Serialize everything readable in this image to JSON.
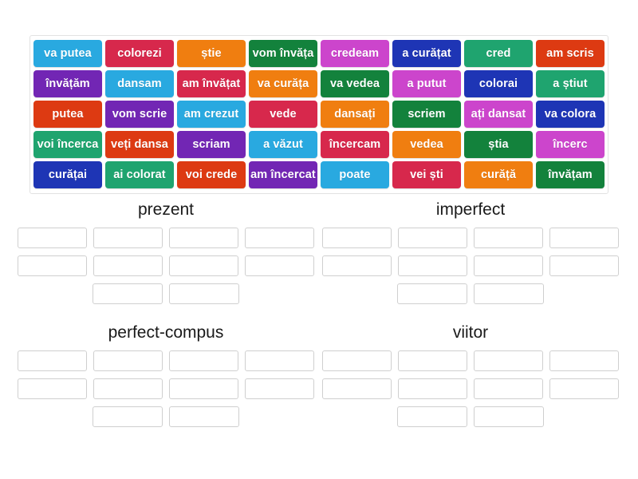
{
  "app": {
    "type": "drag-and-drop-group-sort-activity",
    "language": "ro"
  },
  "palette": {
    "sky": "#29a9e0",
    "crimson": "#d7284c",
    "orange": "#f07e10",
    "forest": "#13823c",
    "orchid": "#cc45cc",
    "navy": "#1e35b5",
    "emerald": "#1fa46f",
    "vermilion": "#dd3a12",
    "purple": "#7226b4"
  },
  "word_bank": {
    "name": "word-bank",
    "rows": [
      [
        {
          "label": "va putea",
          "color": "#29a9e0"
        },
        {
          "label": "colorezi",
          "color": "#d7284c"
        },
        {
          "label": "știe",
          "color": "#f07e10"
        },
        {
          "label": "vom învăța",
          "color": "#13823c"
        },
        {
          "label": "credeam",
          "color": "#cc45cc"
        },
        {
          "label": "a curățat",
          "color": "#1e35b5"
        },
        {
          "label": "cred",
          "color": "#1fa46f"
        },
        {
          "label": "am scris",
          "color": "#dd3a12"
        }
      ],
      [
        {
          "label": "învățăm",
          "color": "#7226b4"
        },
        {
          "label": "dansam",
          "color": "#29a9e0"
        },
        {
          "label": "am învățat",
          "color": "#d7284c"
        },
        {
          "label": "va curăța",
          "color": "#f07e10"
        },
        {
          "label": "va vedea",
          "color": "#13823c"
        },
        {
          "label": "a putut",
          "color": "#cc45cc"
        },
        {
          "label": "colorai",
          "color": "#1e35b5"
        },
        {
          "label": "a știut",
          "color": "#1fa46f"
        }
      ],
      [
        {
          "label": "putea",
          "color": "#dd3a12"
        },
        {
          "label": "vom scrie",
          "color": "#7226b4"
        },
        {
          "label": "am crezut",
          "color": "#29a9e0"
        },
        {
          "label": "vede",
          "color": "#d7284c"
        },
        {
          "label": "dansați",
          "color": "#f07e10"
        },
        {
          "label": "scriem",
          "color": "#13823c"
        },
        {
          "label": "ați dansat",
          "color": "#cc45cc"
        },
        {
          "label": "va colora",
          "color": "#1e35b5"
        }
      ],
      [
        {
          "label": "voi încerca",
          "color": "#1fa46f"
        },
        {
          "label": "veți dansa",
          "color": "#dd3a12"
        },
        {
          "label": "scriam",
          "color": "#7226b4"
        },
        {
          "label": "a văzut",
          "color": "#29a9e0"
        },
        {
          "label": "încercam",
          "color": "#d7284c"
        },
        {
          "label": "vedea",
          "color": "#f07e10"
        },
        {
          "label": "știa",
          "color": "#13823c"
        },
        {
          "label": "încerc",
          "color": "#cc45cc"
        }
      ],
      [
        {
          "label": "curățai",
          "color": "#1e35b5"
        },
        {
          "label": "ai colorat",
          "color": "#1fa46f"
        },
        {
          "label": "voi crede",
          "color": "#dd3a12"
        },
        {
          "label": "am încercat",
          "color": "#7226b4"
        },
        {
          "label": "poate",
          "color": "#29a9e0"
        },
        {
          "label": "vei ști",
          "color": "#d7284c"
        },
        {
          "label": "curăță",
          "color": "#f07e10"
        },
        {
          "label": "învățam",
          "color": "#13823c"
        }
      ]
    ]
  },
  "categories": [
    {
      "title": "prezent",
      "slots_per_row": [
        4,
        4,
        2
      ],
      "filled": []
    },
    {
      "title": "imperfect",
      "slots_per_row": [
        4,
        4,
        2
      ],
      "filled": []
    },
    {
      "title": "perfect-compus",
      "slots_per_row": [
        4,
        4,
        2
      ],
      "filled": []
    },
    {
      "title": "viitor",
      "slots_per_row": [
        4,
        4,
        2
      ],
      "filled": []
    }
  ]
}
